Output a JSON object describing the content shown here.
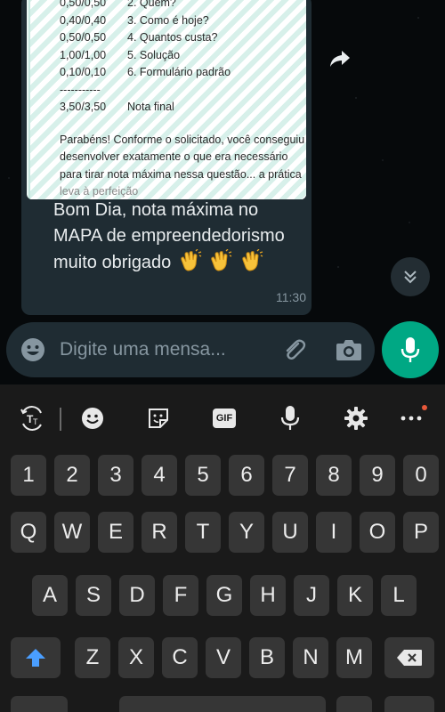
{
  "chat": {
    "attachment": {
      "rows": [
        {
          "score": "0,50/0,50",
          "label": "2. Quem?"
        },
        {
          "score": "0,40/0,40",
          "label": "3. Como é hoje?"
        },
        {
          "score": "0,50/0,50",
          "label": "4. Quantos custa?"
        },
        {
          "score": "1,00/1,00",
          "label": "5. Solução"
        },
        {
          "score": "0,10/0,10",
          "label": "6. Formulário padrão"
        }
      ],
      "separator": "-----------",
      "final_score": "3,50/3,50",
      "final_label": "Nota final",
      "paragraph": [
        "Parabéns! Conforme o solicitado, você conseguiu",
        "desenvolver exatamente o que era necessário",
        "para tirar nota máxima nessa questão... a prática",
        "leva à perfeição"
      ]
    },
    "message": {
      "line1": "Bom Dia, nota máxima no",
      "line2": "MAPA de empreendedorismo",
      "line3": "muito obrigado",
      "time": "11:30"
    }
  },
  "composer": {
    "placeholder": "Digite uma mensa..."
  },
  "keyboard": {
    "toolbar_gif": "GIF",
    "row_numbers": [
      "1",
      "2",
      "3",
      "4",
      "5",
      "6",
      "7",
      "8",
      "9",
      "0"
    ],
    "row_top": [
      "Q",
      "W",
      "E",
      "R",
      "T",
      "Y",
      "U",
      "I",
      "O",
      "P"
    ],
    "row_home": [
      "A",
      "S",
      "D",
      "F",
      "G",
      "H",
      "J",
      "K",
      "L"
    ],
    "row_bottom": [
      "Z",
      "X",
      "C",
      "V",
      "B",
      "N",
      "M"
    ]
  },
  "colors": {
    "accent": "#00a884",
    "bubble": "#1f2c33",
    "key": "#363636",
    "shift": "#4a9eff"
  }
}
